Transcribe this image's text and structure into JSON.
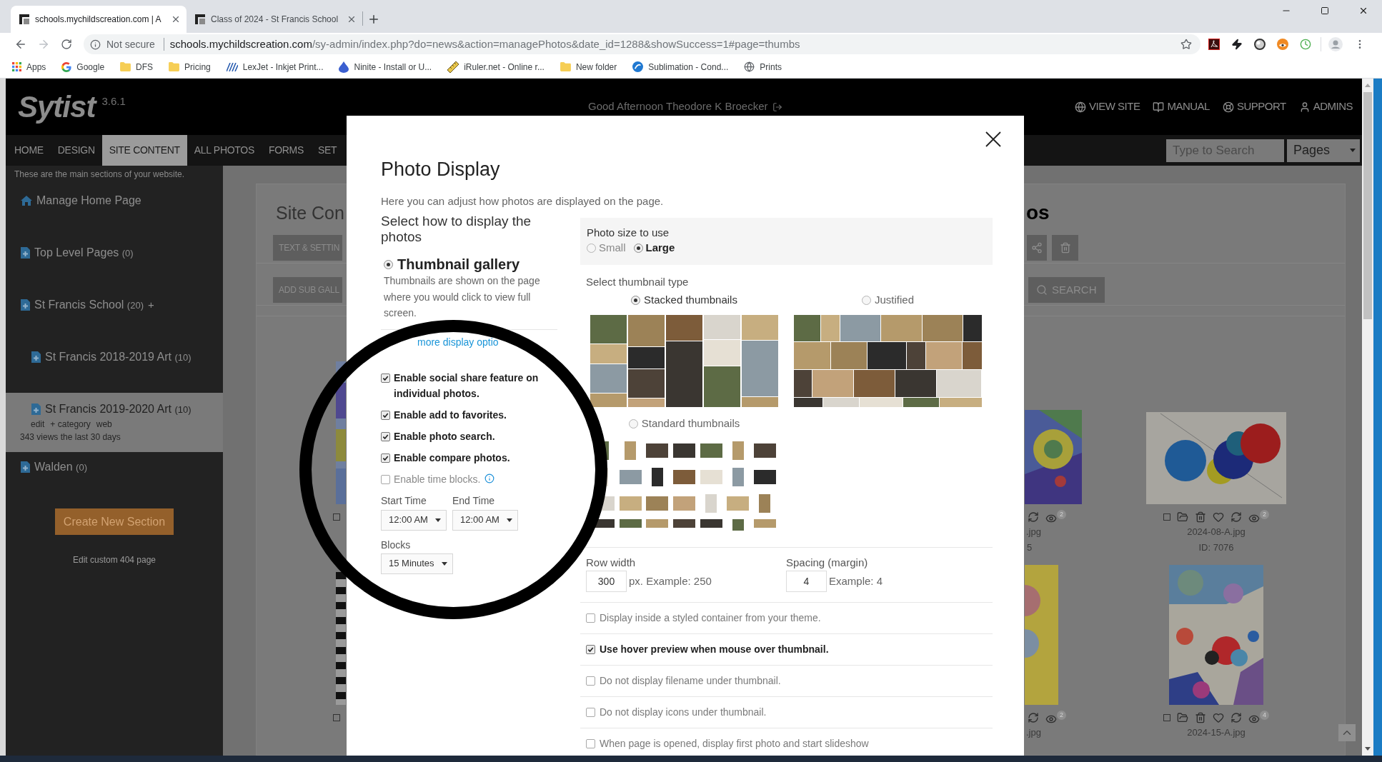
{
  "browser": {
    "tabs": [
      {
        "title": "schools.mychildscreation.com | A",
        "selected": true
      },
      {
        "title": "Class of 2024 - St Francis School",
        "selected": false
      }
    ],
    "security_label": "Not secure",
    "url": {
      "host": "schools.mychildscreation.com",
      "path": "/sy-admin/index.php?do=news&action=managePhotos&date_id=1288&showSuccess=1#page=thumbs"
    },
    "bookmarks": [
      {
        "label": "Apps",
        "kind": "apps"
      },
      {
        "label": "Google",
        "kind": "google"
      },
      {
        "label": "DFS",
        "kind": "folder"
      },
      {
        "label": "Pricing",
        "kind": "folder"
      },
      {
        "label": "LexJet - Inkjet Print...",
        "kind": "stripes"
      },
      {
        "label": "Ninite - Install or U...",
        "kind": "drop"
      },
      {
        "label": "iRuler.net - Online r...",
        "kind": "ruler"
      },
      {
        "label": "New folder",
        "kind": "folder"
      },
      {
        "label": "Sublimation - Cond...",
        "kind": "swirl"
      },
      {
        "label": "Prints",
        "kind": "globe"
      }
    ]
  },
  "header": {
    "logo": "Sytist",
    "version": "3.6.1",
    "greeting": "Good Afternoon Theodore K Broecker",
    "links": [
      {
        "label": "VIEW SITE",
        "kind": "globe"
      },
      {
        "label": "MANUAL",
        "kind": "book"
      },
      {
        "label": "SUPPORT",
        "kind": "lifebuoy"
      },
      {
        "label": "ADMINS",
        "kind": "user"
      }
    ]
  },
  "nav": {
    "items": [
      {
        "label": "HOME",
        "selected": false
      },
      {
        "label": "DESIGN",
        "selected": false
      },
      {
        "label": "SITE CONTENT",
        "selected": true
      },
      {
        "label": "ALL PHOTOS",
        "selected": false
      },
      {
        "label": "FORMS",
        "selected": false
      },
      {
        "label": "SET",
        "selected": false
      }
    ],
    "search": {
      "placeholder": "Type to Search"
    },
    "scope": "Pages"
  },
  "sidebar": {
    "intro": "These are the main sections of your website.",
    "items": [
      {
        "label": "Manage Home Page",
        "kind": "home",
        "selected": false
      },
      {
        "label": "Top Level Pages",
        "count": "(0)",
        "kind": "page",
        "selected": false
      },
      {
        "label": "St Francis School",
        "count": "(20)",
        "add": "+",
        "kind": "page",
        "selected": false,
        "children": [
          {
            "label": "St Francis 2018-2019 Art",
            "count": "(10)",
            "kind": "page",
            "selected": false
          },
          {
            "label": "St Francis 2019-2020 Art",
            "count": "(10)",
            "kind": "page",
            "selected": true,
            "links": [
              "edit",
              "+ category",
              "web"
            ],
            "views": "343 views the last 30 days"
          }
        ]
      },
      {
        "label": "Walden",
        "count": "(0)",
        "kind": "page",
        "selected": false
      }
    ],
    "create_button": "Create New Section",
    "footer_link": "Edit custom 404 page"
  },
  "content": {
    "title": "Site Con",
    "title_right": "os",
    "buttons": [
      "TEXT & SETTIN",
      "ADD SUB GALL"
    ],
    "search_button": "SEARCH",
    "photo_rows": [
      [
        {
          "kind": "sliver",
          "checked": false
        },
        {
          "kind": "partial",
          "views": "2",
          "filename": ".jpg",
          "id": "5"
        },
        {
          "kind": "full",
          "checked": false,
          "views": "2",
          "filename": "2024-08-A.jpg",
          "id": "ID: 7076"
        }
      ],
      [
        {
          "kind": "sliver",
          "checked": false
        },
        {
          "kind": "partial",
          "views": "2",
          "filename": ".jpg"
        },
        {
          "kind": "full",
          "checked": false,
          "views": "4",
          "filename": "2024-15-A.jpg"
        }
      ]
    ]
  },
  "dialog": {
    "title": "Photo Display",
    "intro": "Here you can adjust how photos are displayed on the page.",
    "display_heading": "Select how to display the photos",
    "display_modes": [
      {
        "label": "Thumbnail gallery",
        "selected": true,
        "description": "Thumbnails are shown on the page where you would click to view full screen."
      }
    ],
    "more_link": "more display optio",
    "features": [
      {
        "label": "Enable social share feature on individual photos.",
        "checked": true
      },
      {
        "label": "Enable add to favorites.",
        "checked": true
      },
      {
        "label": "Enable photo search.",
        "checked": true
      },
      {
        "label": "Enable compare photos.",
        "checked": true
      },
      {
        "label": "Enable time blocks.",
        "checked": false,
        "info": true
      }
    ],
    "start_time": {
      "label": "Start Time",
      "value": "12:00 AM"
    },
    "end_time": {
      "label": "End Time",
      "value": "12:00 AM"
    },
    "blocks": {
      "label": "Blocks",
      "value": "15 Minutes"
    },
    "photo_size": {
      "label": "Photo size to use",
      "options": [
        {
          "label": "Small",
          "selected": false
        },
        {
          "label": "Large",
          "selected": true
        }
      ]
    },
    "thumbnail_type": {
      "label": "Select thumbnail type",
      "options": [
        {
          "label": "Stacked thumbnails",
          "kind": "stacked",
          "selected": true
        },
        {
          "label": "Justified",
          "kind": "justified",
          "selected": false
        },
        {
          "label": "Standard thumbnails",
          "kind": "standard",
          "selected": false
        }
      ]
    },
    "row_width": {
      "label": "Row width",
      "value": "300",
      "hint": "px. Example: 250"
    },
    "spacing": {
      "label": "Spacing (margin)",
      "value": "4",
      "hint": "Example: 4"
    },
    "options": [
      {
        "label": "Display inside a styled container from your theme.",
        "checked": false
      },
      {
        "label": "Use hover preview when mouse over thumbnail.",
        "checked": true
      },
      {
        "label": "Do not display filename under thumbnail.",
        "checked": false
      },
      {
        "label": "Do not display icons under thumbnail.",
        "checked": false
      },
      {
        "label": "When page is opened, display first photo and start slideshow",
        "checked": false
      }
    ]
  }
}
